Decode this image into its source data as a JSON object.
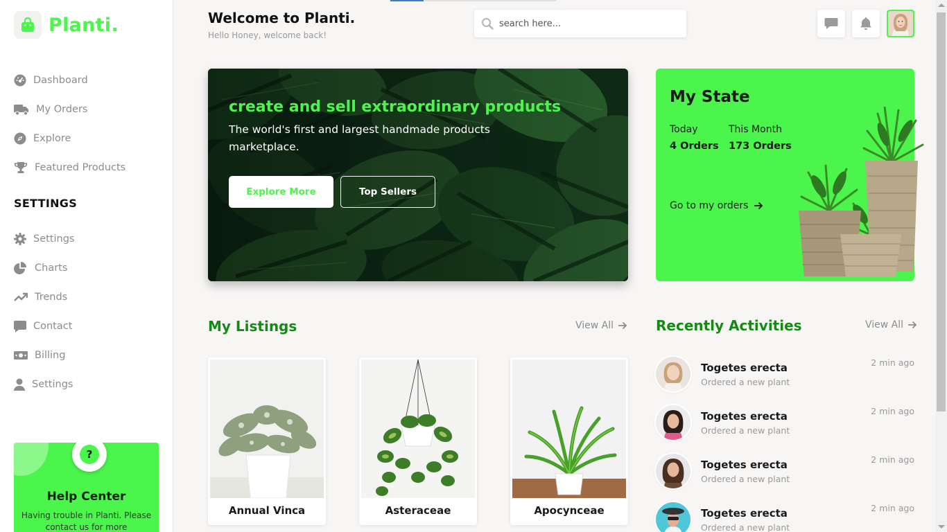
{
  "app": {
    "name": "Planti."
  },
  "sidebar": {
    "items": [
      {
        "label": "Dashboard",
        "icon": "dashboard-gauge-icon"
      },
      {
        "label": "My Orders",
        "icon": "truck-icon"
      },
      {
        "label": "Explore",
        "icon": "compass-icon"
      },
      {
        "label": "Featured Products",
        "icon": "trophy-icon"
      }
    ],
    "settings_heading": "SETTINGS",
    "settings_items": [
      {
        "label": "Settings",
        "icon": "gear-icon"
      },
      {
        "label": "Charts",
        "icon": "pie-chart-icon"
      },
      {
        "label": "Trends",
        "icon": "trend-up-icon"
      },
      {
        "label": "Contact",
        "icon": "chat-bubble-icon"
      },
      {
        "label": "Billing",
        "icon": "money-bill-icon"
      },
      {
        "label": "Settings",
        "icon": "user-icon"
      }
    ],
    "help": {
      "badge": "?",
      "title": "Help Center",
      "text": "Having trouble in Planti. Please contact us for more"
    }
  },
  "header": {
    "title": "Welcome to Planti.",
    "subtitle": "Hello Honey, welcome back!",
    "search_placeholder": "search here..."
  },
  "hero": {
    "title": "create and sell extraordinary products",
    "subtitle": "The world's first and largest handmade products marketplace.",
    "primary_button": "Explore More",
    "secondary_button": "Top Sellers"
  },
  "state": {
    "title": "My State",
    "today_label": "Today",
    "today_value": "4 Orders",
    "month_label": "This Month",
    "month_value": "173 Orders",
    "link": "Go to my orders"
  },
  "listings": {
    "title": "My Listings",
    "view_all": "View All",
    "items": [
      {
        "name": "Annual Vinca"
      },
      {
        "name": "Asteraceae"
      },
      {
        "name": "Apocynceae"
      }
    ]
  },
  "activities": {
    "title": "Recently Activities",
    "view_all": "View All",
    "items": [
      {
        "name": "Togetes erecta",
        "action": "Ordered a new plant",
        "time": "2 min ago"
      },
      {
        "name": "Togetes erecta",
        "action": "Ordered a new plant",
        "time": "2 min ago"
      },
      {
        "name": "Togetes erecta",
        "action": "Ordered a new plant",
        "time": "2 min ago"
      },
      {
        "name": "Togetes erecta",
        "action": "Ordered a new plant",
        "time": "2 min ago"
      }
    ]
  },
  "colors": {
    "accent": "#4cf54c",
    "heading_green": "#138a13",
    "muted": "#8c8c8c",
    "background": "#f8f6f5"
  }
}
